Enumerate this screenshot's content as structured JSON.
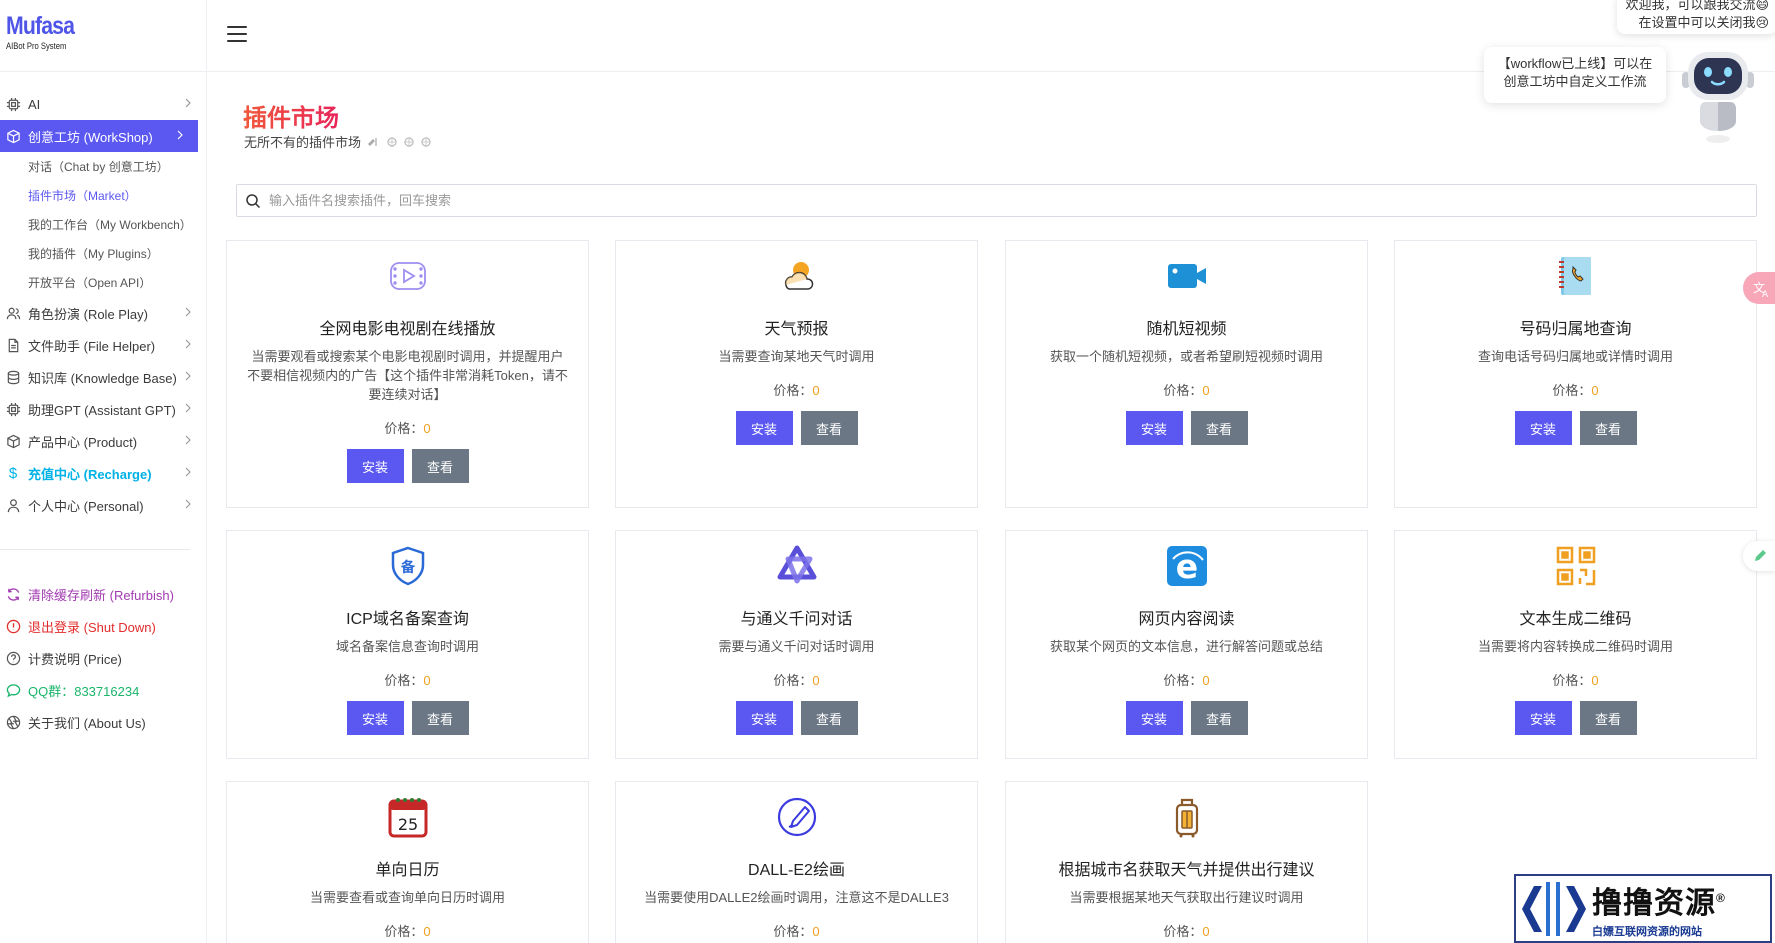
{
  "logo": {
    "name": "Mufasa",
    "subtitle": "AIBot Pro System"
  },
  "sidebar": {
    "items": [
      {
        "label": "AI",
        "icon": "chip-icon"
      },
      {
        "label": "创意工坊 (WorkShop)",
        "icon": "cube-icon",
        "active": true
      },
      {
        "label": "角色扮演 (Role Play)",
        "icon": "users-icon"
      },
      {
        "label": "文件助手 (File Helper)",
        "icon": "file-icon"
      },
      {
        "label": "知识库 (Knowledge Base)",
        "icon": "database-icon"
      },
      {
        "label": "助理GPT (Assistant GPT)",
        "icon": "chip-icon"
      },
      {
        "label": "产品中心 (Product)",
        "icon": "box-icon"
      },
      {
        "label": "充值中心 (Recharge)",
        "icon": "dollar-icon"
      },
      {
        "label": "个人中心 (Personal)",
        "icon": "user-icon"
      }
    ],
    "sub_items": [
      "对话（Chat by 创意工坊）",
      "插件市场（Market）",
      "我的工作台（My Workbench）",
      "我的插件（My Plugins）",
      "开放平台（Open API）"
    ],
    "bottom": [
      {
        "label": "清除缓存刷新 (Refurbish)",
        "icon": "refresh-icon"
      },
      {
        "label": "退出登录 (Shut Down)",
        "icon": "alert-icon"
      },
      {
        "label": "计费说明 (Price)",
        "icon": "question-icon"
      },
      {
        "label": "QQ群：833716234",
        "icon": "chat-icon"
      },
      {
        "label": "关于我们 (About Us)",
        "icon": "aperture-icon"
      }
    ]
  },
  "page": {
    "title": "插件市场",
    "subtitle": "无所不有的插件市场"
  },
  "search": {
    "placeholder": "输入插件名搜索插件，回车搜索"
  },
  "labels": {
    "price": "价格：",
    "install": "安装",
    "view": "查看"
  },
  "plugins": [
    {
      "title": "全网电影电视剧在线播放",
      "desc": "当需要观看或搜索某个电影电视剧时调用，并提醒用户不要相信视频内的广告【这个插件非常消耗Token，请不要连续对话】",
      "price": "0",
      "icon": "video-play-icon"
    },
    {
      "title": "天气预报",
      "desc": "当需要查询某地天气时调用",
      "price": "0",
      "icon": "weather-icon"
    },
    {
      "title": "随机短视频",
      "desc": "获取一个随机短视频，或者希望刷短视频时调用",
      "price": "0",
      "icon": "camera-icon"
    },
    {
      "title": "号码归属地查询",
      "desc": "查询电话号码归属地或详情时调用",
      "price": "0",
      "icon": "phonebook-icon"
    },
    {
      "title": "ICP域名备案查询",
      "desc": "域名备案信息查询时调用",
      "price": "0",
      "icon": "shield-icon"
    },
    {
      "title": "与通义千问对话",
      "desc": "需要与通义千问对话时调用",
      "price": "0",
      "icon": "tongyi-icon"
    },
    {
      "title": "网页内容阅读",
      "desc": "获取某个网页的文本信息，进行解答问题或总结",
      "price": "0",
      "icon": "browser-icon"
    },
    {
      "title": "文本生成二维码",
      "desc": "当需要将内容转换成二维码时调用",
      "price": "0",
      "icon": "qrcode-icon"
    },
    {
      "title": "单向日历",
      "desc": "当需要查看或查询单向日历时调用",
      "price": "0",
      "icon": "calendar-icon"
    },
    {
      "title": "DALL-E2绘画",
      "desc": "当需要使用DALLE2绘画时调用，注意这不是DALLE3",
      "price": "0",
      "icon": "brush-icon"
    },
    {
      "title": "根据城市名获取天气并提供出行建议",
      "desc": "当需要根据某地天气获取出行建议时调用",
      "price": "0",
      "icon": "luggage-icon"
    }
  ],
  "assistant": {
    "tip_top": [
      "欢迎我，可以跟我交流😄",
      "在设置中可以关闭我😢"
    ],
    "bubble": [
      "【workflow已上线】可以在",
      "创意工坊中自定义工作流"
    ]
  },
  "watermark": {
    "main": "撸撸资源",
    "sub": "白嫖互联网资源的网站",
    "mark": "®"
  },
  "colors": {
    "accent": "#5b58f2",
    "view_button": "#6b7785",
    "price_value": "#f0a020",
    "title_gradient": [
      "#f0583a",
      "#e8255a"
    ]
  }
}
